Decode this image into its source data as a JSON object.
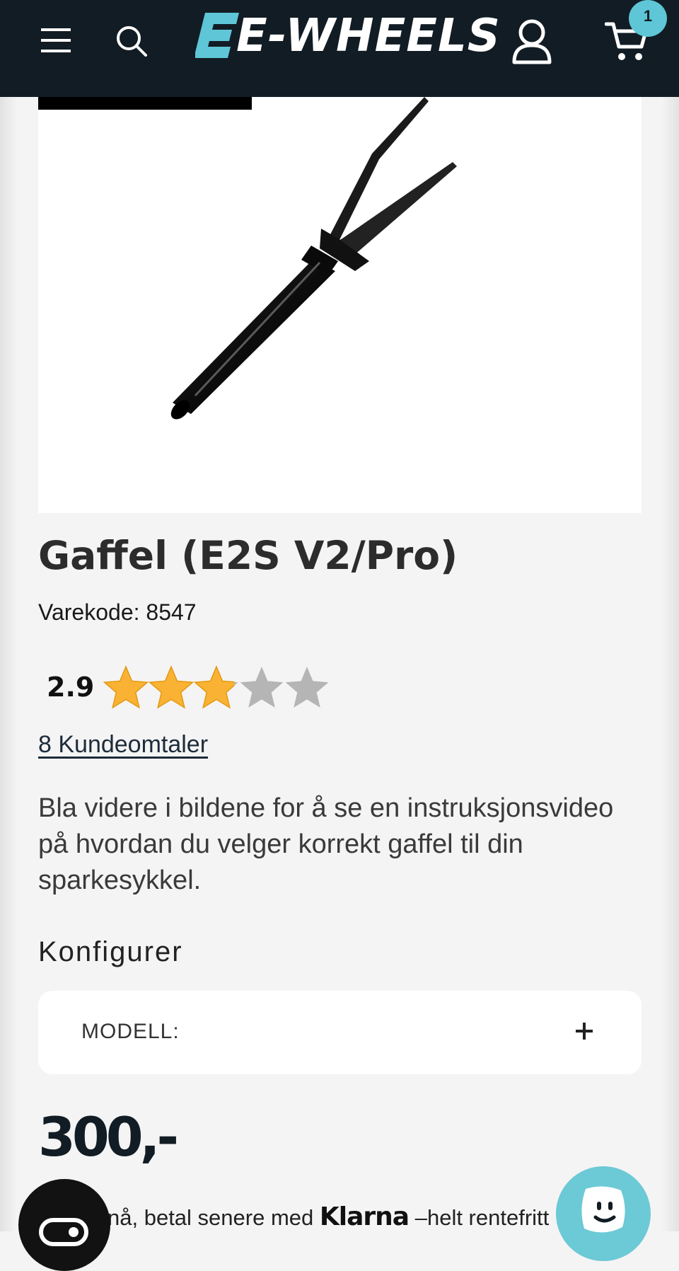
{
  "header": {
    "logo_text": "E-WHEELS",
    "cart_count": "1",
    "colors": {
      "header_bg": "#121c24",
      "accent": "#5ec6d6"
    },
    "icons": [
      "menu-icon",
      "search-icon",
      "account-icon",
      "cart-icon"
    ]
  },
  "product": {
    "title": "Gaffel (E2S V2/Pro)",
    "sku": "Varekode: 8547",
    "rating": {
      "score": "2.9",
      "value": 2.9,
      "max": 5,
      "star_color": "#f9b233",
      "empty_star_color": "#b5b5b5"
    },
    "reviews_link": "8 Kundeomtaler",
    "description": "Bla videre i bildene for å se en instruksjonsvideo på hvordan du velger korrekt gaffel til din sparkesykkel.",
    "configure_heading": "Konfigurer",
    "model_label": "MODELL:",
    "price": "300,-"
  },
  "klarna": {
    "prefix": "nå, betal senere med",
    "brand": "Klarna",
    "suffix": "–helt rentefritt"
  }
}
